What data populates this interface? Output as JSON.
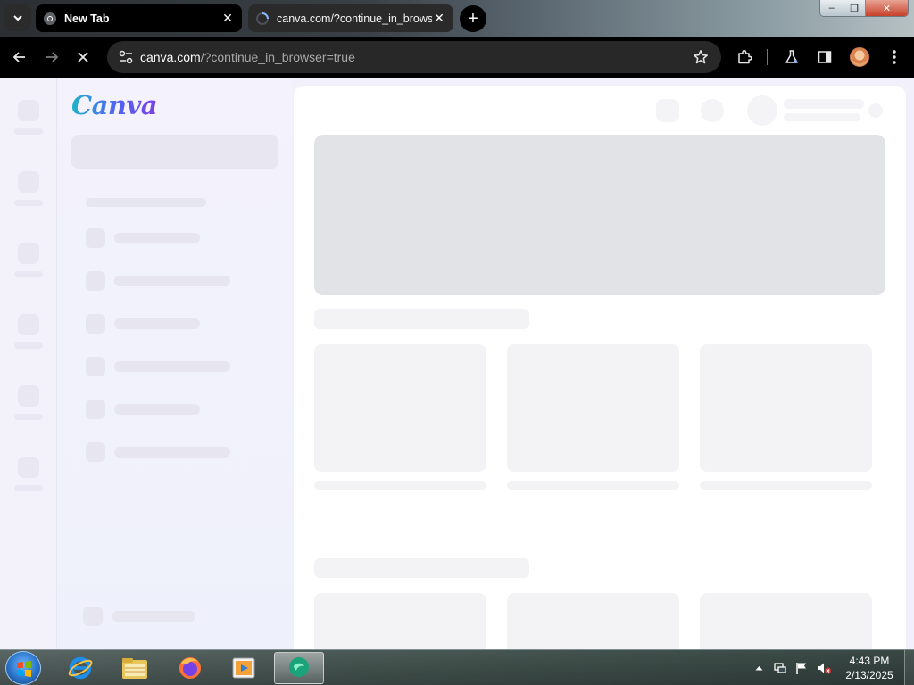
{
  "browser": {
    "tabs": [
      {
        "title": "New Tab",
        "active": false
      },
      {
        "title": "canva.com/?continue_in_browser=true",
        "active": true,
        "loading": true
      }
    ],
    "address_bar": {
      "host": "canva.com",
      "path": "/?continue_in_browser=true"
    },
    "window_controls": {
      "minimize": "–",
      "maximize": "❐",
      "close": "✕"
    },
    "new_tab_label": "+"
  },
  "page": {
    "logo_text": "Canva",
    "state": "loading-skeleton"
  },
  "taskbar": {
    "apps": [
      "internet-explorer",
      "file-explorer",
      "firefox",
      "media-player",
      "active-app"
    ],
    "clock": {
      "time": "4:43 PM",
      "date": "2/13/2025"
    }
  },
  "colors": {
    "canva_gradient_start": "#1fb3c6",
    "canva_gradient_end": "#7b3fe4",
    "skeleton": "#f3f3f5",
    "hero_skeleton": "#e1e3e6"
  }
}
